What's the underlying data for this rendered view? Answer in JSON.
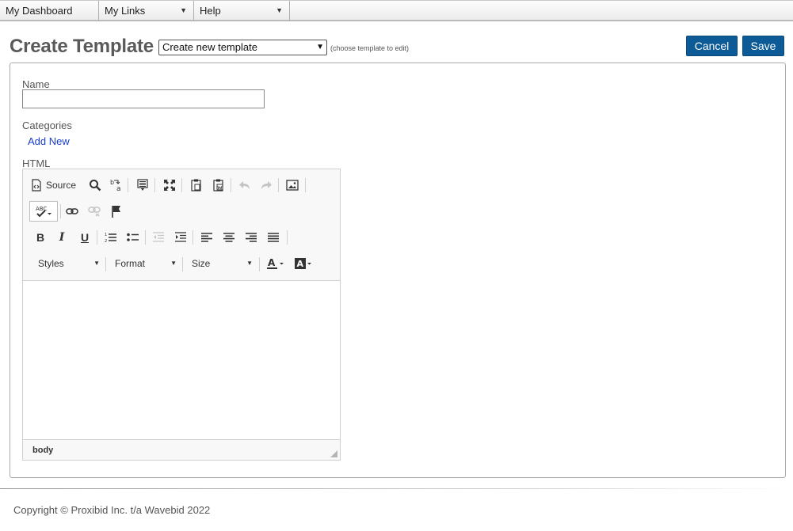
{
  "nav": {
    "items": [
      {
        "label": "My Dashboard"
      },
      {
        "label": "My Links"
      },
      {
        "label": "Help"
      }
    ]
  },
  "header": {
    "title": "Create Template",
    "template_select_value": "Create new template",
    "template_hint": "(choose template to edit)",
    "cancel_label": "Cancel",
    "save_label": "Save"
  },
  "form": {
    "name_label": "Name",
    "name_value": "",
    "categories_label": "Categories",
    "add_new_label": "Add New",
    "html_label": "HTML"
  },
  "editor": {
    "source_label": "Source",
    "styles_label": "Styles",
    "format_label": "Format",
    "size_label": "Size",
    "path_label": "body",
    "icons": [
      "source-icon",
      "find-icon",
      "replace-icon",
      "select-all-icon",
      "maximize-icon",
      "paste-icon",
      "paste-word-icon",
      "undo-icon",
      "redo-icon",
      "image-icon",
      "spellcheck-icon",
      "link-icon",
      "unlink-icon",
      "anchor-icon",
      "bold-icon",
      "italic-icon",
      "underline-icon",
      "numbered-list-icon",
      "bulleted-list-icon",
      "outdent-icon",
      "indent-icon",
      "align-left-icon",
      "align-center-icon",
      "align-right-icon",
      "justify-icon",
      "text-color-icon",
      "bg-color-icon"
    ]
  },
  "colors": {
    "button_primary": "#0c5a96",
    "link": "#1a3fc9"
  },
  "footer": {
    "copyright": "Copyright © Proxibid Inc. t/a Wavebid 2022"
  }
}
